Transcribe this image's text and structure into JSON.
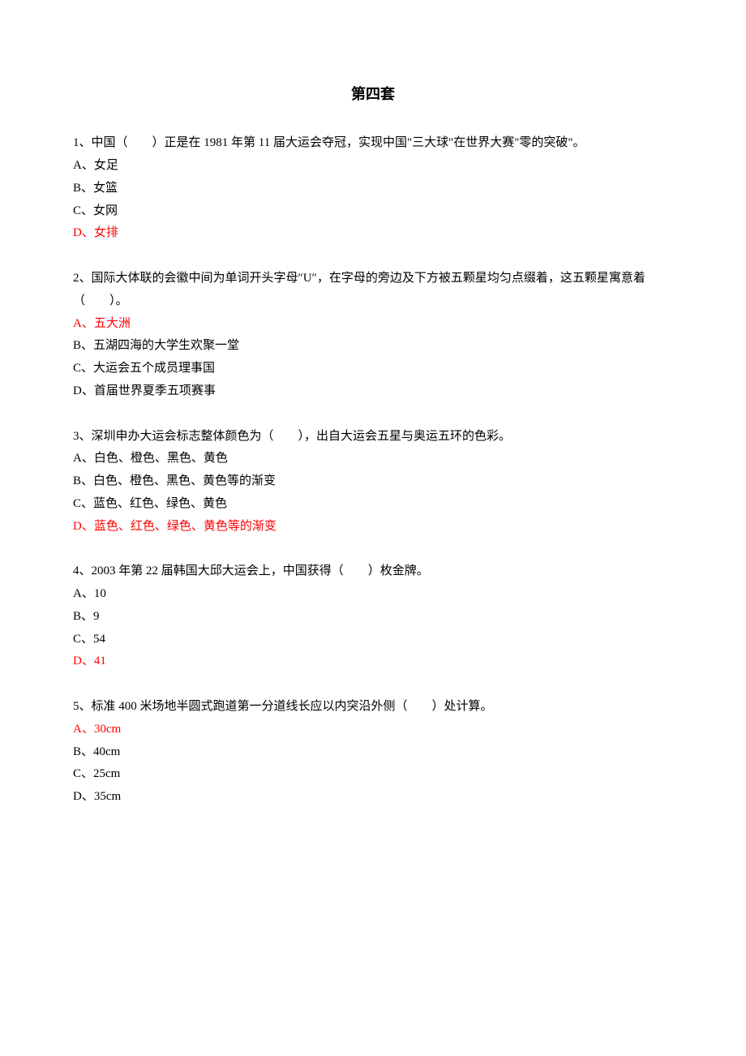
{
  "title": "第四套",
  "questions": [
    {
      "text": "1、中国（　　）正是在 1981 年第 11 届大运会夺冠，实现中国\"三大球\"在世界大赛\"零的突破\"。",
      "options": [
        {
          "label": "A、女足",
          "highlight": false
        },
        {
          "label": "B、女篮",
          "highlight": false
        },
        {
          "label": "C、女网",
          "highlight": false
        },
        {
          "label": "D、女排",
          "highlight": true
        }
      ]
    },
    {
      "text": "2、国际大体联的会徽中间为单词开头字母″U″，在字母的旁边及下方被五颗星均匀点缀着，这五颗星寓意着（　　）。",
      "options": [
        {
          "label": "A、五大洲",
          "highlight": true
        },
        {
          "label": "B、五湖四海的大学生欢聚一堂",
          "highlight": false
        },
        {
          "label": "C、大运会五个成员理事国",
          "highlight": false
        },
        {
          "label": "D、首届世界夏季五项赛事",
          "highlight": false
        }
      ]
    },
    {
      "text": "3、深圳申办大运会标志整体颜色为（　　），出自大运会五星与奥运五环的色彩。",
      "options": [
        {
          "label": "A、白色、橙色、黑色、黄色",
          "highlight": false
        },
        {
          "label": "B、白色、橙色、黑色、黄色等的渐变",
          "highlight": false
        },
        {
          "label": "C、蓝色、红色、绿色、黄色",
          "highlight": false
        },
        {
          "label": "D、蓝色、红色、绿色、黄色等的渐变",
          "highlight": true
        }
      ]
    },
    {
      "text": "4、2003 年第 22 届韩国大邱大运会上，中国获得（　　）枚金牌。",
      "options": [
        {
          "label": "A、10",
          "highlight": false
        },
        {
          "label": "B、9",
          "highlight": false
        },
        {
          "label": "C、54",
          "highlight": false
        },
        {
          "label": "D、41",
          "highlight": true
        }
      ]
    },
    {
      "text": "5、标准 400 米场地半圆式跑道第一分道线长应以内突沿外侧（　　）处计算。",
      "options": [
        {
          "label": "A、30cm",
          "highlight": true
        },
        {
          "label": "B、40cm",
          "highlight": false
        },
        {
          "label": "C、25cm",
          "highlight": false
        },
        {
          "label": "D、35cm",
          "highlight": false
        }
      ]
    }
  ]
}
